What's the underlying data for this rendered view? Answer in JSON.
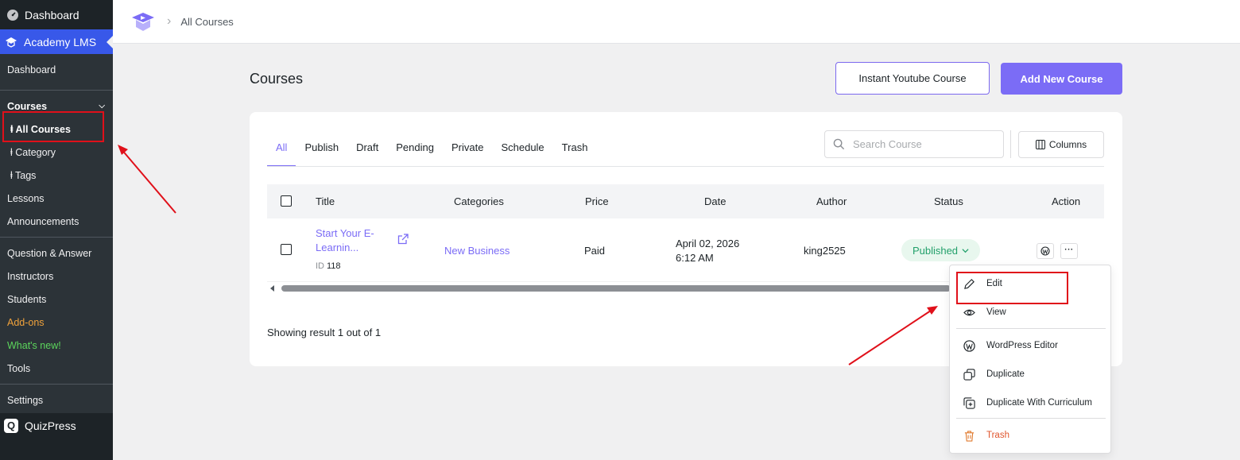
{
  "sidebar": {
    "wp_dashboard": "Dashboard",
    "academy": "Academy LMS",
    "items": {
      "dashboard": "Dashboard",
      "courses": "Courses",
      "all_courses": "ⱡ All Courses",
      "category": "ⱡ Category",
      "tags": "ⱡ Tags",
      "lessons": "Lessons",
      "announcements": "Announcements",
      "qa": "Question & Answer",
      "instructors": "Instructors",
      "students": "Students",
      "addons": "Add-ons",
      "whats_new": "What's new!",
      "tools": "Tools",
      "settings": "Settings"
    },
    "quizpress": "QuizPress"
  },
  "header": {
    "breadcrumb": "All Courses"
  },
  "page": {
    "title": "Courses",
    "instant_youtube": "Instant Youtube Course",
    "add_new": "Add New Course"
  },
  "tabs": [
    "All",
    "Publish",
    "Draft",
    "Pending",
    "Private",
    "Schedule",
    "Trash"
  ],
  "search": {
    "placeholder": "Search Course"
  },
  "columns_label": "Columns",
  "table": {
    "headers": {
      "title": "Title",
      "categories": "Categories",
      "price": "Price",
      "date": "Date",
      "author": "Author",
      "status": "Status",
      "action": "Action"
    },
    "rows": [
      {
        "title_line1": "Start Your E-",
        "title_line2": "Learnin...",
        "id_label": "ID",
        "id": "118",
        "category": "New Business",
        "price": "Paid",
        "date_line1": "April 02, 2026",
        "date_line2": "6:12 AM",
        "author": "king2525",
        "status": "Published"
      }
    ]
  },
  "showing": "Showing result 1 out of 1",
  "dropdown": {
    "edit": "Edit",
    "view": "View",
    "wp_editor": "WordPress Editor",
    "duplicate": "Duplicate",
    "duplicate_curriculum": "Duplicate With Curriculum",
    "trash": "Trash"
  },
  "colors": {
    "accent": "#7b6cf6",
    "success": "#22a06b",
    "danger": "#d63638",
    "highlight": "#e0101a"
  }
}
